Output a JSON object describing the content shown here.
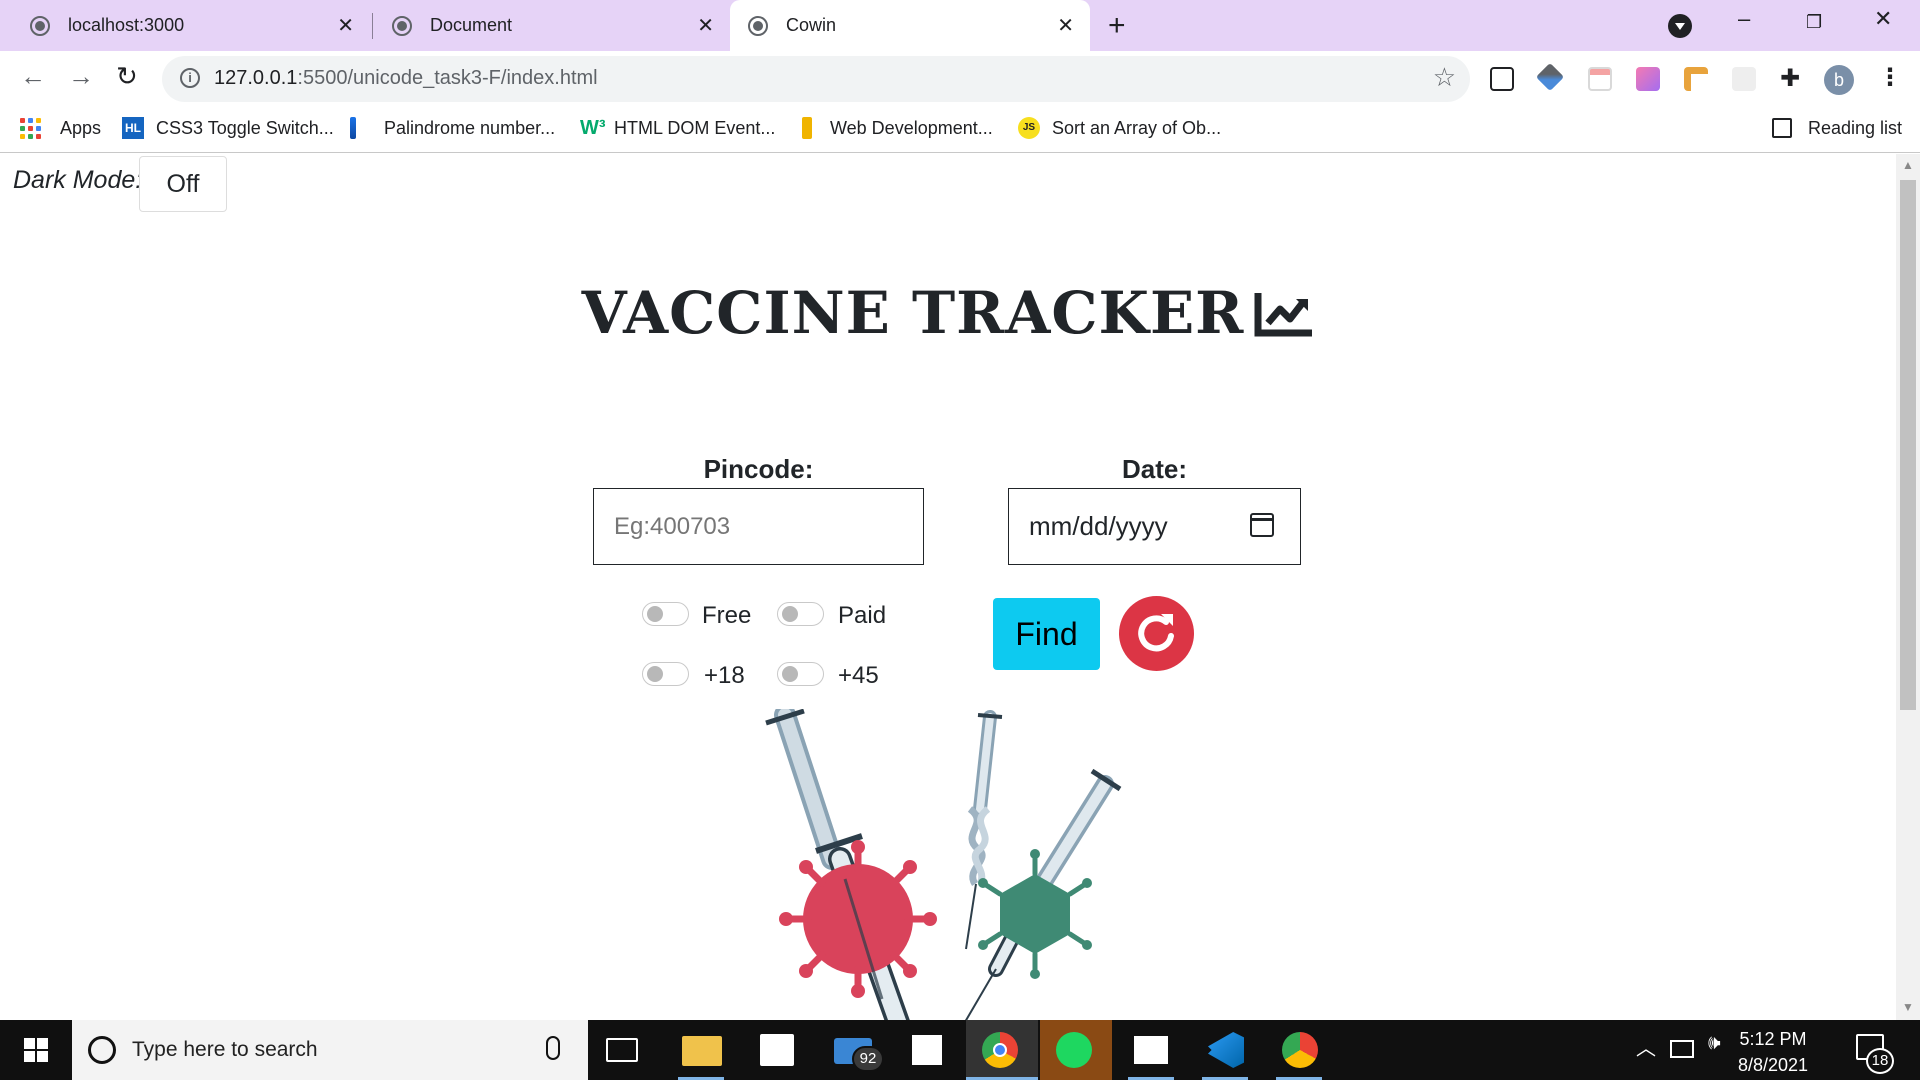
{
  "browser": {
    "tabs": [
      {
        "title": "localhost:3000",
        "active": false
      },
      {
        "title": "Document",
        "active": false
      },
      {
        "title": "Cowin",
        "active": true
      }
    ],
    "address": {
      "host": "127.0.0.1",
      "path": ":5500/unicode_task3-F/index.html"
    },
    "bookmarks": [
      {
        "label": "Apps",
        "icon": "apps-grid-icon"
      },
      {
        "label": "CSS3 Toggle Switch...",
        "icon": "hl-icon"
      },
      {
        "label": "Palindrome number...",
        "icon": "bookmark-icon"
      },
      {
        "label": "HTML DOM Event...",
        "icon": "w3-icon"
      },
      {
        "label": "Web Development...",
        "icon": "bookmark-icon"
      },
      {
        "label": "Sort an Array of Ob...",
        "icon": "js-icon"
      }
    ],
    "reading_list": "Reading list",
    "profile_initial": "b"
  },
  "page": {
    "dark_mode_label": "Dark Mode:",
    "dark_mode_value": "Off",
    "title": "VACCINE TRACKER",
    "pincode_label": "Pincode:",
    "pincode_placeholder": "Eg:400703",
    "date_label": "Date:",
    "date_placeholder": "mm/dd/yyyy",
    "filters": [
      {
        "label": "Free",
        "checked": false
      },
      {
        "label": "Paid",
        "checked": false
      },
      {
        "label": "+18",
        "checked": false
      },
      {
        "label": "+45",
        "checked": false
      }
    ],
    "find_label": "Find",
    "colors": {
      "find": "#0dcaf0",
      "reset": "#dc3545",
      "virus_red": "#d9435b",
      "virus_green": "#3f8a74"
    }
  },
  "taskbar": {
    "search_placeholder": "Type here to search",
    "mail_badge": "92",
    "time": "5:12 PM",
    "date": "8/8/2021",
    "notifications": "18"
  }
}
